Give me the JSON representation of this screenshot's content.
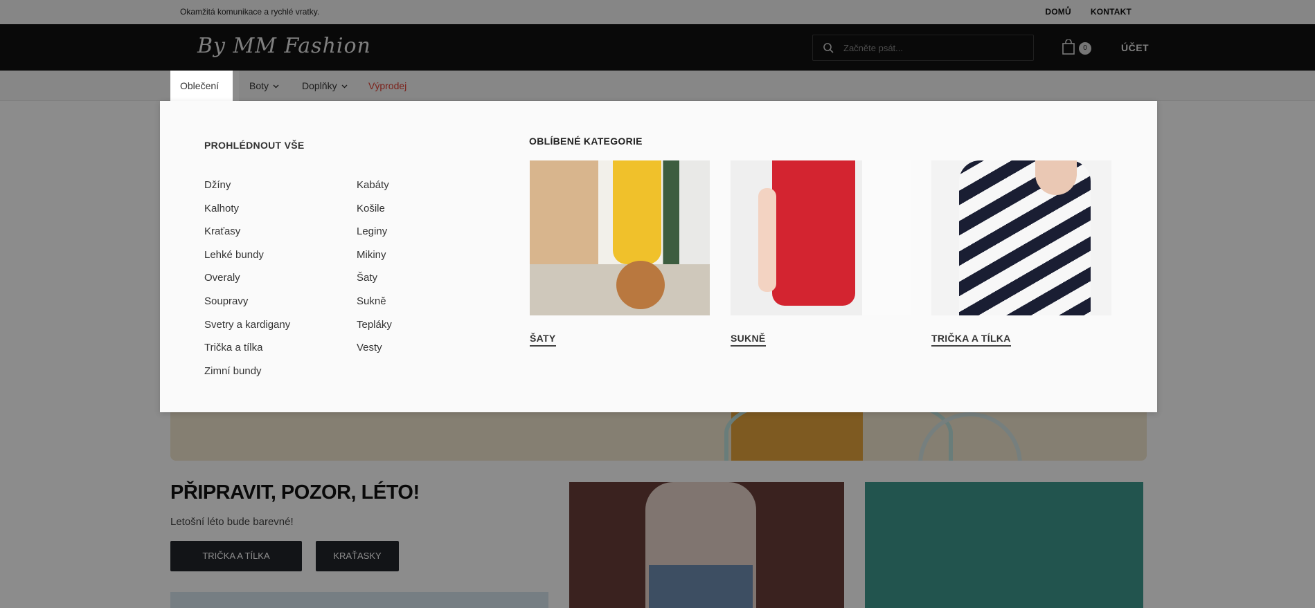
{
  "topbar": {
    "message": "Okamžitá komunikace a rychlé vratky.",
    "links": [
      "DOMŮ",
      "KONTAKT"
    ]
  },
  "header": {
    "logo": "By MM Fashion",
    "search_placeholder": "Začněte psát...",
    "cart_count": "0",
    "account_label": "ÚČET"
  },
  "nav": {
    "items": [
      {
        "label": "Oblečení",
        "active": true
      },
      {
        "label": "Boty"
      },
      {
        "label": "Doplňky"
      },
      {
        "label": "Výprodej"
      }
    ]
  },
  "mega_menu": {
    "browse_all": "PROHLÉDNOUT VŠE",
    "col1": [
      "Džíny",
      "Kalhoty",
      "Kraťasy",
      "Lehké bundy",
      "Overaly",
      "Soupravy",
      "Svetry a kardigany",
      "Trička a tílka",
      "Zimní bundy"
    ],
    "col2": [
      "Kabáty",
      "Košile",
      "Leginy",
      "Mikiny",
      "Šaty",
      "Sukně",
      "Tepláky",
      "Vesty"
    ],
    "favorites_title": "OBLÍBENÉ KATEGORIE",
    "cards": [
      "ŠATY",
      "SUKNĚ",
      "TRIČKA A TÍLKA"
    ]
  },
  "promo": {
    "title": "PŘIPRAVIT, POZOR, LÉTO!",
    "subtitle": "Letošní léto bude barevné!",
    "buttons": [
      "TRIČKA A TÍLKA",
      "KRAŤASKY"
    ]
  },
  "colors": {
    "header_bg": "#121212",
    "sale": "#e03c31",
    "button_bg": "#22252b"
  }
}
